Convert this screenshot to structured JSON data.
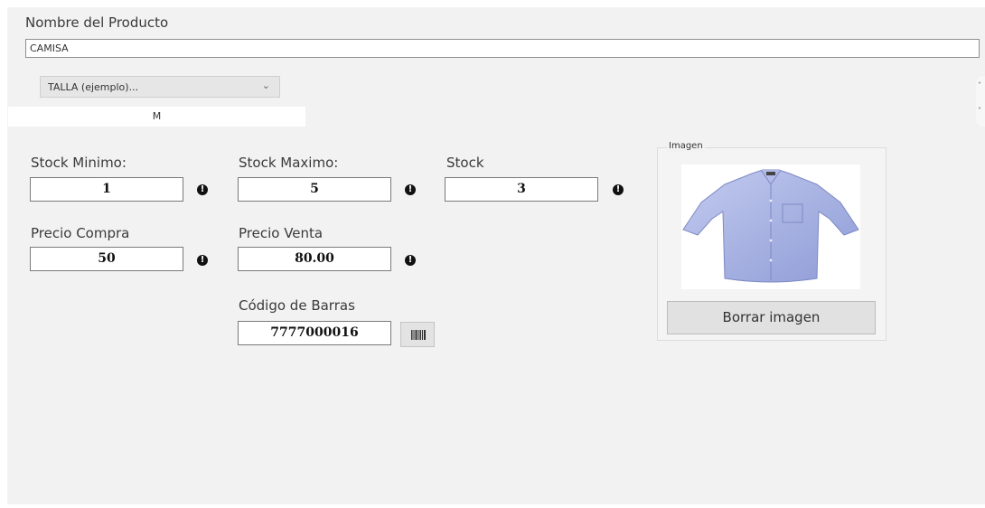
{
  "form": {
    "product_name_label": "Nombre del Producto",
    "product_name_value": "CAMISA",
    "size_select_value": "TALLA (ejemplo)...",
    "size_value": "M",
    "stock_min_label": "Stock Minimo:",
    "stock_min_value": "1",
    "stock_max_label": "Stock Maximo:",
    "stock_max_value": "5",
    "stock_label": "Stock",
    "stock_value": "3",
    "buy_price_label": "Precio Compra",
    "buy_price_value": "50",
    "sell_price_label": "Precio Venta",
    "sell_price_value": "80.00",
    "barcode_label": "Código de Barras",
    "barcode_value": "7777000016"
  },
  "image_panel": {
    "legend": "Imagen",
    "clear_button_label": "Borrar imagen"
  },
  "icons": {
    "warning": "exclamation-circle-icon",
    "barcode": "barcode-icon",
    "dropdown": "chevron-down-icon"
  },
  "colors": {
    "panel_bg": "#f2f2f2",
    "shirt": "#aeb8e6"
  }
}
